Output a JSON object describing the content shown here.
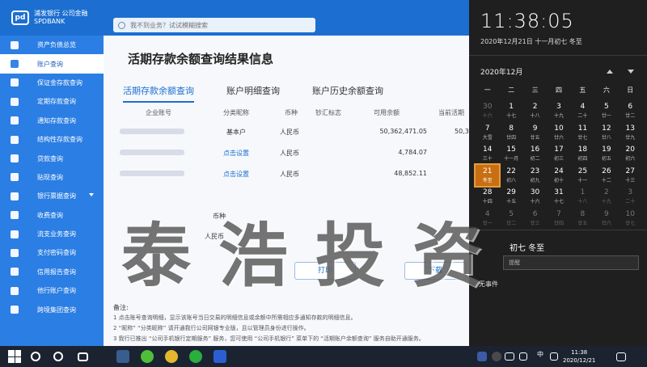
{
  "app": {
    "logo_text": "浦发银行 公司金融",
    "logo_sub": "SPDBANK",
    "search_placeholder": "我不到业务？试试模糊搜索"
  },
  "sidebar": {
    "items": [
      {
        "label": "资产负债总览"
      },
      {
        "label": "账户查询"
      },
      {
        "label": "保证金存款查询"
      },
      {
        "label": "定期存款查询"
      },
      {
        "label": "通知存款查询"
      },
      {
        "label": "结构性存款查询"
      },
      {
        "label": "贷款查询"
      },
      {
        "label": "贴现查询"
      },
      {
        "label": "银行票据查询"
      },
      {
        "label": "收费查询"
      },
      {
        "label": "流支业务查询"
      },
      {
        "label": "支付密码查询"
      },
      {
        "label": "信用报告查询"
      },
      {
        "label": "他行账户查询"
      },
      {
        "label": "跨境集团查询"
      }
    ],
    "active_index": 1
  },
  "main": {
    "title": "活期存款余额查询结果信息",
    "tabs": [
      "活期存款余额查询",
      "账户明细查询",
      "账户历史余额查询"
    ],
    "columns": [
      "企业账号",
      "分类昵称",
      "币种",
      "钞汇标志",
      "可用余额",
      "当前活期"
    ],
    "rows": [
      {
        "nickname": "基本户",
        "currency": "人民币",
        "balance": "50,362,471.05",
        "current": "50,3"
      },
      {
        "nickname": "点击设置",
        "currency": "人民币",
        "balance": "4,784.07",
        "current": ""
      },
      {
        "nickname": "点击设置",
        "currency": "人民币",
        "balance": "48,852.11",
        "current": ""
      }
    ],
    "summary_currency_label": "币种",
    "summary_currency_value": "人民币",
    "print_button": "打印",
    "download_button": "下载",
    "notes_title": "备注:",
    "notes": [
      "1  点击账号查询明细，显示该账号当日交易的明细信息或余额中所需相应多通知存款的明细信息。",
      "2  “昵称” “分类昵称” 请开通我行公司网银专业版，且以管理员身份进行操作。",
      "3  我行已推出 “公司手机银行定期服务” 服务，您可使用 “公司手机银行” 菜单下的 “活期账户余额查询” 服务自助开通服务。"
    ]
  },
  "watermark": "泰浩投资",
  "calendar": {
    "time": "11:38:05",
    "full_date": "2020年12月21日 十一月初七 冬至",
    "month_title": "2020年12月",
    "weekdays": [
      "一",
      "二",
      "三",
      "四",
      "五",
      "六",
      "日"
    ],
    "days": [
      {
        "d": "30",
        "l": "十六",
        "dim": true
      },
      {
        "d": "1",
        "l": "十七"
      },
      {
        "d": "2",
        "l": "十八"
      },
      {
        "d": "3",
        "l": "十九"
      },
      {
        "d": "4",
        "l": "二十"
      },
      {
        "d": "5",
        "l": "廿一"
      },
      {
        "d": "6",
        "l": "廿二"
      },
      {
        "d": "7",
        "l": "大雪"
      },
      {
        "d": "8",
        "l": "廿四"
      },
      {
        "d": "9",
        "l": "廿五"
      },
      {
        "d": "10",
        "l": "廿六"
      },
      {
        "d": "11",
        "l": "廿七"
      },
      {
        "d": "12",
        "l": "廿八"
      },
      {
        "d": "13",
        "l": "廿九"
      },
      {
        "d": "14",
        "l": "三十"
      },
      {
        "d": "15",
        "l": "十一月"
      },
      {
        "d": "16",
        "l": "初二"
      },
      {
        "d": "17",
        "l": "初三"
      },
      {
        "d": "18",
        "l": "初四"
      },
      {
        "d": "19",
        "l": "初五"
      },
      {
        "d": "20",
        "l": "初六"
      },
      {
        "d": "21",
        "l": "冬至",
        "today": true
      },
      {
        "d": "22",
        "l": "初八"
      },
      {
        "d": "23",
        "l": "初九"
      },
      {
        "d": "24",
        "l": "初十"
      },
      {
        "d": "25",
        "l": "十一"
      },
      {
        "d": "26",
        "l": "十二"
      },
      {
        "d": "27",
        "l": "十三"
      },
      {
        "d": "28",
        "l": "十四"
      },
      {
        "d": "29",
        "l": "十五"
      },
      {
        "d": "30",
        "l": "十六"
      },
      {
        "d": "31",
        "l": "十七"
      },
      {
        "d": "1",
        "l": "十八",
        "dim": true
      },
      {
        "d": "2",
        "l": "十九",
        "dim": true
      },
      {
        "d": "3",
        "l": "二十",
        "dim": true
      },
      {
        "d": "4",
        "l": "廿一",
        "dim": true
      },
      {
        "d": "5",
        "l": "廿二",
        "dim": true
      },
      {
        "d": "6",
        "l": "廿三",
        "dim": true
      },
      {
        "d": "7",
        "l": "廿四",
        "dim": true
      },
      {
        "d": "8",
        "l": "廿五",
        "dim": true
      },
      {
        "d": "9",
        "l": "廿六",
        "dim": true
      },
      {
        "d": "10",
        "l": "廿七",
        "dim": true
      }
    ],
    "event_date": "初七 冬至",
    "event_placeholder": "提醒",
    "no_event": "无事件"
  },
  "taskbar": {
    "tray_lang": "中",
    "time": "11:38",
    "date": "2020/12/21"
  }
}
